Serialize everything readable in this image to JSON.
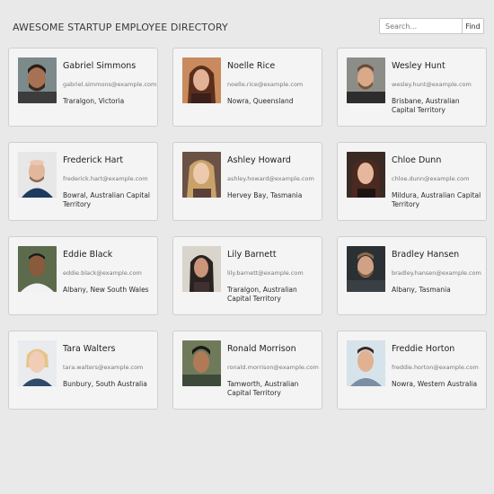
{
  "header": {
    "title": "AWESOME STARTUP EMPLOYEE DIRECTORY",
    "search_placeholder": "Search...",
    "find_label": "Find"
  },
  "employees": [
    {
      "name": "Gabriel Simmons",
      "email": "gabriel.simmons@example.com",
      "location": "Traralgon, Victoria"
    },
    {
      "name": "Noelle Rice",
      "email": "noelle.rice@example.com",
      "location": "Nowra, Queensland"
    },
    {
      "name": "Wesley Hunt",
      "email": "wesley.hunt@example.com",
      "location": "Brisbane, Australian Capital Territory"
    },
    {
      "name": "Frederick Hart",
      "email": "frederick.hart@example.com",
      "location": "Bowral, Australian Capital Territory"
    },
    {
      "name": "Ashley Howard",
      "email": "ashley.howard@example.com",
      "location": "Hervey Bay, Tasmania"
    },
    {
      "name": "Chloe Dunn",
      "email": "chloe.dunn@example.com",
      "location": "Mildura, Australian Capital Territory"
    },
    {
      "name": "Eddie Black",
      "email": "eddie.black@example.com",
      "location": "Albany, New South Wales"
    },
    {
      "name": "Lily Barnett",
      "email": "lily.barnett@example.com",
      "location": "Traralgon, Australian Capital Territory"
    },
    {
      "name": "Bradley Hansen",
      "email": "bradley.hansen@example.com",
      "location": "Albany, Tasmania"
    },
    {
      "name": "Tara Walters",
      "email": "tara.walters@example.com",
      "location": "Bunbury, South Australia"
    },
    {
      "name": "Ronald Morrison",
      "email": "ronald.morrison@example.com",
      "location": "Tamworth, Australian Capital Territory"
    },
    {
      "name": "Freddie Horton",
      "email": "freddie.horton@example.com",
      "location": "Nowra, Western Australia"
    }
  ]
}
